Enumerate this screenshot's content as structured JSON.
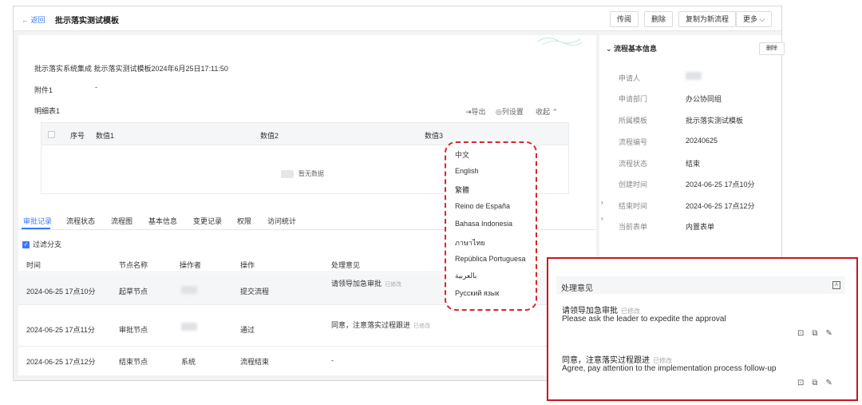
{
  "header": {
    "back_label": "← 返回",
    "title": "批示落实测试模板",
    "buttons": [
      "传阅",
      "删除",
      "复制为新流程",
      "更多 ⌵"
    ]
  },
  "form": {
    "subject": "批示落实系统集成  批示落实测试模板2024年6月25日17:11:50",
    "attachment_label": "附件1",
    "attachment_value": "-",
    "detail_table_label": "明细表1",
    "export_label": "⇥导出",
    "column_settings_label": "◎列设置",
    "collapse_label": "收起 ⌃",
    "table_headers": [
      "序号",
      "数值1",
      "数值2",
      "数值3"
    ],
    "empty_text": "暂无数据"
  },
  "tabs": {
    "items": [
      "审批记录",
      "流程状态",
      "流程图",
      "基本信息",
      "变更记录",
      "权限",
      "访问统计"
    ],
    "active_index": 0
  },
  "records": {
    "filter_label": "过滤分支",
    "headers": [
      "时间",
      "节点名称",
      "操作者",
      "操作",
      "处理意见"
    ],
    "rows": [
      {
        "time": "2024-06-25 17点10分",
        "node": "起草节点",
        "operator": "",
        "action": "提交流程",
        "opinion": "请领导加急审批",
        "edited": "已修改"
      },
      {
        "time": "2024-06-25 17点11分",
        "node": "审批节点",
        "operator": "",
        "action": "通过",
        "opinion": "同意，注意落实过程跟进",
        "edited": "已修改"
      },
      {
        "time": "2024-06-25 17点12分",
        "node": "结束节点",
        "operator": "系统",
        "action": "流程结束",
        "opinion": "-",
        "edited": ""
      }
    ]
  },
  "info": {
    "title": "⌄ 流程基本信息",
    "button": "删除",
    "fields": [
      {
        "label": "申请人",
        "value": ""
      },
      {
        "label": "申请部门",
        "value": "办公协同组"
      },
      {
        "label": "所属模板",
        "value": "批示落实测试模板"
      },
      {
        "label": "流程编号",
        "value": "20240625"
      },
      {
        "label": "流程状态",
        "value": "结束"
      },
      {
        "label": "创建时间",
        "value": "2024-06-25 17点10分"
      },
      {
        "label": "结束时间",
        "value": "2024-06-25 17点12分"
      },
      {
        "label": "当前表单",
        "value": "内置表单"
      }
    ]
  },
  "languages": [
    "中文",
    "English",
    "繁體",
    "Reino de España",
    "Bahasa Indonesia",
    "ภาษาไทย",
    "República Portuguesa",
    "بالعربية",
    "Русский язык"
  ],
  "zoom": {
    "title": "处理意见",
    "entries": [
      {
        "cn": "请领导加急审批",
        "edited": "已修改",
        "en": "Please ask the leader to expedite the approval"
      },
      {
        "cn": "同意，注意落实过程跟进",
        "edited": "已修改",
        "en": "Agree, pay attention to the implementation process follow-up"
      }
    ]
  },
  "colors": {
    "accent": "#3a7afe",
    "highlight_red": "#c8161d"
  }
}
